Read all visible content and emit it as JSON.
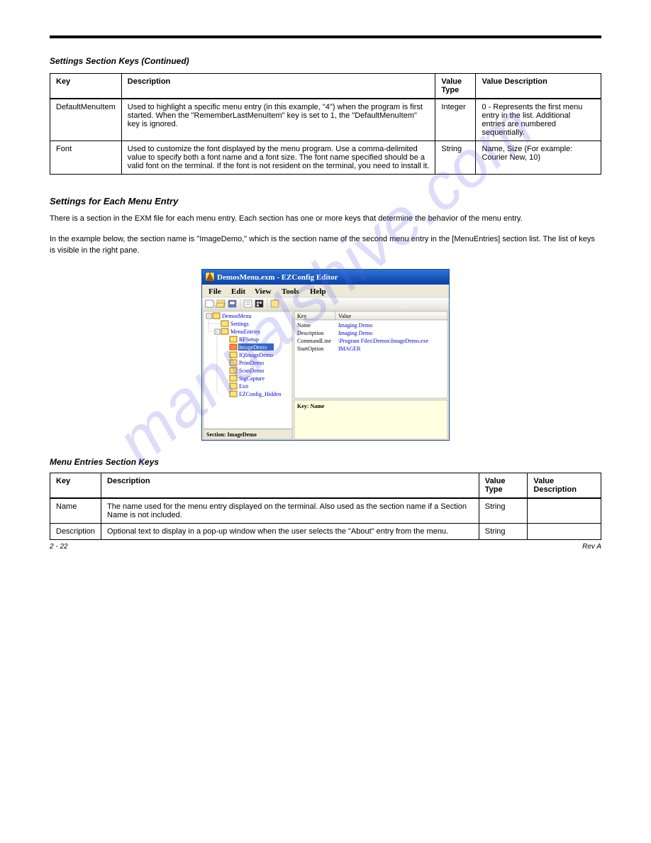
{
  "watermark": "manualshive.com",
  "section1": {
    "caption": "Settings Section Keys (Continued)",
    "table": {
      "headers": [
        "Key",
        "Description",
        "Value Type",
        "Value Description"
      ],
      "rows": [
        {
          "key": "DefaultMenuItem",
          "desc": "Used to highlight a specific menu entry (in this example, \"4\") when the program is first started. When the \"RememberLastMenuItem\" key is set to 1, the \"DefaultMenuItem\" key is ignored.",
          "vtype": "Integer",
          "vdesc": "0 - Represents the first menu entry in the list. Additional entries are numbered sequentially."
        },
        {
          "key": "Font",
          "desc": "Used to customize the font displayed by the menu program. Use a comma-delimited value to specify both a font name and a font size. The font name specified should be a valid font on the terminal. If the font is not resident on the terminal, you need to install it.",
          "vtype": "String",
          "vdesc": "Name, Size (For example: Courier New, 10)"
        }
      ]
    }
  },
  "section2": {
    "heading": "Settings for Each Menu Entry",
    "para1": "There is a section in the EXM file for each menu entry. Each section has one or more keys that determine the behavior of the menu entry.",
    "para2": "In the example below, the section name is \"ImageDemo,\" which is the section name of the second menu entry in the [MenuEntries] section list. The list of keys is visible in the right pane.",
    "caption": "Menu Entries Section Keys",
    "table": {
      "headers": [
        "Key",
        "Description",
        "Value Type",
        "Value Description"
      ],
      "rows": [
        {
          "key": "Name",
          "desc": "The name used for the menu entry displayed on the terminal. Also used as the section name if a Section Name is not included.",
          "vtype": "String",
          "vdesc": ""
        },
        {
          "key": "Description",
          "desc": "Optional text to display in a pop-up window when the user selects the \"About\" entry from the menu.",
          "vtype": "String",
          "vdesc": ""
        }
      ]
    }
  },
  "screenshot": {
    "titlebar": "DemosMenu.exm - EZConfig Editor",
    "menu": [
      "File",
      "Edit",
      "View",
      "Tools",
      "Help"
    ],
    "tree_root": "DemosMenu",
    "tree_items": [
      "Settings",
      "MenuEntries"
    ],
    "tree_sub": [
      "RFSetup",
      "ImageDemo",
      "IQImageDemo",
      "PrintDemo",
      "ScanDemo",
      "SigCapture",
      "Exit",
      "EZConfig_Hidden"
    ],
    "selected": "ImageDemo",
    "headers": [
      "Key",
      "Value"
    ],
    "kv": [
      [
        "Name",
        "Imaging Demo"
      ],
      [
        "Description",
        "Imaging Demo"
      ],
      [
        "CommandLine",
        "\\Program Files\\Demos\\ImageDemo.exe"
      ],
      [
        "StartOption",
        "IMAGER"
      ]
    ],
    "keyname_label": "Key: Name",
    "section_label": "Section: ImageDemo"
  },
  "footer": {
    "left": "2 - 22",
    "right": "Rev A"
  }
}
